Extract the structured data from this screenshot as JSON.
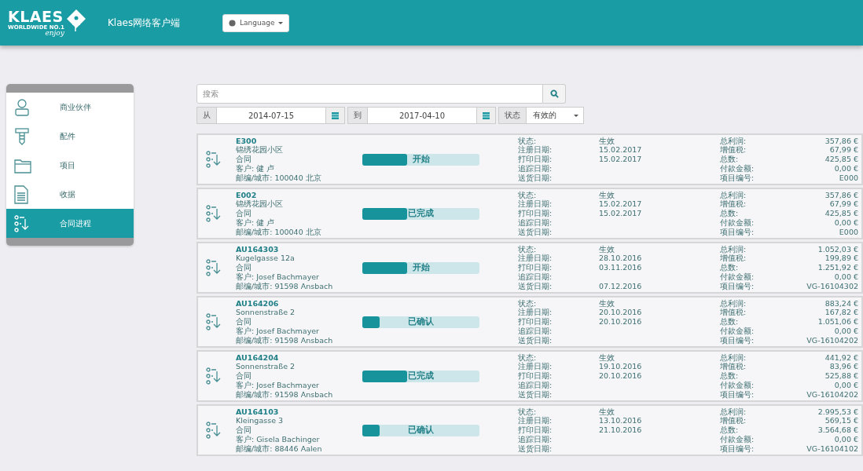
{
  "header": {
    "logo": {
      "name": "KLAES",
      "tagline": "WORLDWIDE NO.1",
      "slogan": "enjoy"
    },
    "title": "Klaes网络客户端",
    "language_button": "Language"
  },
  "sidebar": {
    "items": [
      {
        "label": "商业伙伴",
        "kind": "person",
        "selected": false
      },
      {
        "label": "配件",
        "kind": "bolt",
        "selected": false
      },
      {
        "label": "项目",
        "kind": "folder",
        "selected": false
      },
      {
        "label": "收据",
        "kind": "document",
        "selected": false
      },
      {
        "label": "合同进程",
        "kind": "contract",
        "selected": true
      }
    ]
  },
  "search": {
    "placeholder": "搜索"
  },
  "filters": {
    "from_label": "从",
    "from_date": "2014-07-15",
    "to_label": "到",
    "to_date": "2017-04-10",
    "status_label": "状态",
    "status_value": "有效的"
  },
  "contracts": [
    {
      "number": "E300",
      "address": "锦绣花园小区",
      "type": "合同",
      "customer": "客户: 健 卢",
      "city": "邮编/城市: 100040 北京",
      "progress": {
        "level": 0.38,
        "label": "开始"
      },
      "left_fields": [
        {
          "label": "状态:",
          "value": "生效"
        },
        {
          "label": "注册日期:",
          "value": "15.02.2017"
        },
        {
          "label": "打印日期:",
          "value": "15.02.2017"
        },
        {
          "label": "追踪日期:"
        },
        {
          "label": "送货日期:"
        }
      ],
      "right_fields": [
        {
          "label": "总利润:",
          "value": "357,86 €"
        },
        {
          "label": "增值税:",
          "value": "67,99 €"
        },
        {
          "label": "总数:",
          "value": "425,85 €"
        },
        {
          "label": "付款金额:",
          "value": "0,00 €"
        },
        {
          "label": "项目编号:",
          "value": "E000"
        }
      ]
    },
    {
      "number": "E002",
      "address": "锦绣花园小区",
      "type": "合同",
      "customer": "客户: 健 卢",
      "city": "邮编/城市: 100040 北京",
      "progress": {
        "level": 0.38,
        "label": "已完成"
      },
      "left_fields": [
        {
          "label": "状态:",
          "value": "生效"
        },
        {
          "label": "注册日期:",
          "value": "15.02.2017"
        },
        {
          "label": "打印日期:",
          "value": "15.02.2017"
        },
        {
          "label": "追踪日期:"
        },
        {
          "label": "送货日期:"
        }
      ],
      "right_fields": [
        {
          "label": "总利润:",
          "value": "357,86 €"
        },
        {
          "label": "增值税:",
          "value": "67,99 €"
        },
        {
          "label": "总数:",
          "value": "425,85 €"
        },
        {
          "label": "付款金额:",
          "value": "0,00 €"
        },
        {
          "label": "项目编号:",
          "value": "E000"
        }
      ]
    },
    {
      "number": "AU164303",
      "address": "Kugelgasse 12a",
      "type": "合同",
      "customer": "客户: Josef Bachmayer",
      "city": "邮编/城市: 91598 Ansbach",
      "progress": {
        "level": 0.38,
        "label": "开始"
      },
      "left_fields": [
        {
          "label": "状态:",
          "value": "生效"
        },
        {
          "label": "注册日期:",
          "value": "28.10.2016"
        },
        {
          "label": "打印日期:",
          "value": "03.11.2016"
        },
        {
          "label": "追踪日期:"
        },
        {
          "label": "送货日期:",
          "value": "07.12.2016"
        }
      ],
      "right_fields": [
        {
          "label": "总利润:",
          "value": "1.052,03 €"
        },
        {
          "label": "增值税:",
          "value": "199,89 €"
        },
        {
          "label": "总数:",
          "value": "1.251,92 €"
        },
        {
          "label": "付款金额:",
          "value": "0,00 €"
        },
        {
          "label": "项目编号:",
          "value": "VG-16104302"
        }
      ]
    },
    {
      "number": "AU164206",
      "address": "Sonnenstraße 2",
      "type": "合同",
      "customer": "客户: Josef Bachmayer",
      "city": "邮编/城市: 91598 Ansbach",
      "progress": {
        "level": 0.15,
        "label": "已确认"
      },
      "left_fields": [
        {
          "label": "状态:",
          "value": "生效"
        },
        {
          "label": "注册日期:",
          "value": "20.10.2016"
        },
        {
          "label": "打印日期:",
          "value": "20.10.2016"
        },
        {
          "label": "追踪日期:"
        },
        {
          "label": "送货日期:"
        }
      ],
      "right_fields": [
        {
          "label": "总利润:",
          "value": "883,24 €"
        },
        {
          "label": "增值税:",
          "value": "167,82 €"
        },
        {
          "label": "总数:",
          "value": "1.051,06 €"
        },
        {
          "label": "付款金额:",
          "value": "0,00 €"
        },
        {
          "label": "项目编号:",
          "value": "VG-16104202"
        }
      ]
    },
    {
      "number": "AU164204",
      "address": "Sonnenstraße 2",
      "type": "合同",
      "customer": "客户: Josef Bachmayer",
      "city": "邮编/城市: 91598 Ansbach",
      "progress": {
        "level": 0.38,
        "label": "已完成"
      },
      "left_fields": [
        {
          "label": "状态:",
          "value": "生效"
        },
        {
          "label": "注册日期:",
          "value": "19.10.2016"
        },
        {
          "label": "打印日期:",
          "value": "20.10.2016"
        },
        {
          "label": "追踪日期:"
        },
        {
          "label": "送货日期:"
        }
      ],
      "right_fields": [
        {
          "label": "总利润:",
          "value": "441,92 €"
        },
        {
          "label": "增值税:",
          "value": "83,96 €"
        },
        {
          "label": "总数:",
          "value": "525,88 €"
        },
        {
          "label": "付款金额:",
          "value": "0,00 €"
        },
        {
          "label": "项目编号:",
          "value": "VG-16104202"
        }
      ]
    },
    {
      "number": "AU164103",
      "address": "Kleingasse 3",
      "type": "合同",
      "customer": "客户: Gisela Bachinger",
      "city": "邮编/城市: 88446 Aalen",
      "progress": {
        "level": 0.15,
        "label": "已确认"
      },
      "left_fields": [
        {
          "label": "状态:",
          "value": "生效"
        },
        {
          "label": "注册日期:",
          "value": "13.10.2016"
        },
        {
          "label": "打印日期:",
          "value": "21.10.2016"
        },
        {
          "label": "追踪日期:"
        },
        {
          "label": "送货日期:"
        }
      ],
      "right_fields": [
        {
          "label": "总利润:",
          "value": "2.995,53 €"
        },
        {
          "label": "增值税:",
          "value": "569,15 €"
        },
        {
          "label": "总数:",
          "value": "3.564,68 €"
        },
        {
          "label": "付款金额:",
          "value": "0,00 €"
        },
        {
          "label": "项目编号:",
          "value": "VG-16104102"
        }
      ]
    }
  ]
}
